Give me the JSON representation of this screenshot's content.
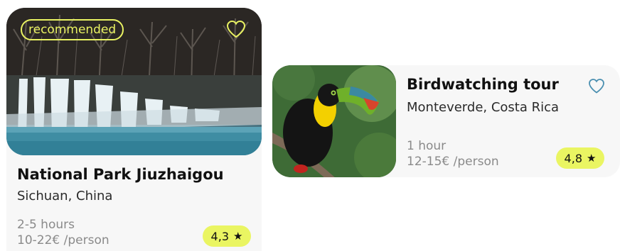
{
  "cards": [
    {
      "badge": "recommended",
      "title": "National Park Jiuzhaigou",
      "location": "Sichuan, China",
      "duration": "2-5 hours",
      "price": "10-22€ /person",
      "rating": "4,3",
      "photo": "waterfall-photo"
    },
    {
      "title": "Birdwatching tour",
      "location": "Monteverde, Costa Rica",
      "duration": "1 hour",
      "price": "12-15€ /person",
      "rating": "4,8",
      "photo": "toucan-photo"
    }
  ],
  "colors": {
    "accent": "#eaf562",
    "heart_card1": "#e9f262",
    "heart_card2": "#4a8fb0",
    "card_bg": "#f7f7f7",
    "muted_text": "#8a8a8a"
  },
  "icons": {
    "favorite": "heart-icon",
    "rating": "star-icon"
  }
}
